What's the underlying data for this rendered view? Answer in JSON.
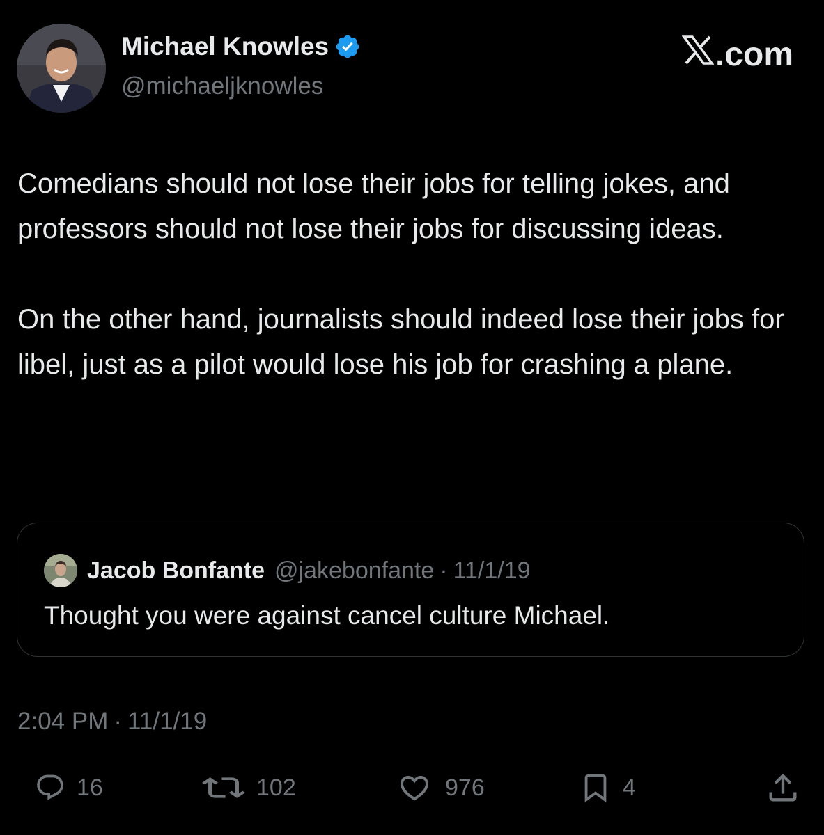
{
  "author": {
    "name": "Michael Knowles",
    "handle": "@michaeljknowles",
    "verified_color": "#1d9bf0"
  },
  "site": {
    "label": ".com"
  },
  "tweet": {
    "paragraphs": [
      "Comedians should not lose their jobs for telling jokes, and professors should not lose their jobs for discussing ideas.",
      "On the other hand, journalists should indeed lose their jobs for libel, just as a pilot would lose his job for crashing a plane."
    ]
  },
  "quote": {
    "name": "Jacob Bonfante",
    "handle": "@jakebonfante",
    "separator": "·",
    "date": "11/1/19",
    "text": "Thought you were against cancel culture Michael."
  },
  "timestamp": {
    "time": "2:04 PM",
    "separator": "·",
    "date": "11/1/19"
  },
  "actions": {
    "replies": "16",
    "reposts": "102",
    "likes": "976",
    "bookmarks": "4"
  },
  "icons": {
    "reply": "reply-icon",
    "repost": "repost-icon",
    "like": "heart-icon",
    "bookmark": "bookmark-icon",
    "share": "share-icon",
    "verified": "verified-badge-icon",
    "logo": "x-logo-icon"
  },
  "colors": {
    "background": "#000000",
    "text_primary": "#e7e9ea",
    "text_secondary": "#71767b",
    "border": "#2f3336"
  }
}
